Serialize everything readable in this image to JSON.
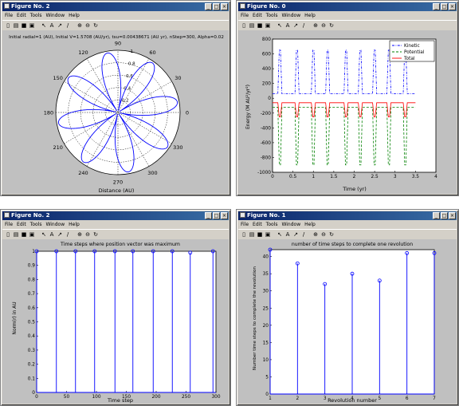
{
  "menu": [
    "File",
    "Edit",
    "Tools",
    "Window",
    "Help"
  ],
  "windows": [
    {
      "title": "Figure No. 2"
    },
    {
      "title": "Figure No. 0"
    },
    {
      "title": "Figure No. 2"
    },
    {
      "title": "Figure No. 1"
    }
  ],
  "window_buttons": [
    "_",
    "□",
    "×"
  ],
  "toolbar_icons": [
    "new-file-icon",
    "open-icon",
    "save-icon",
    "print-icon",
    "select-arrow-icon",
    "text-icon",
    "arrow-icon",
    "line-icon",
    "zoom-in-icon",
    "zoom-out-icon",
    "rotate-icon"
  ],
  "colors": {
    "blue": "#0000ff",
    "green": "#008000",
    "red": "#ff0000",
    "titlebar": "#0a246a"
  },
  "chart_data": [
    {
      "type": "polar",
      "title": "Initial radial=1 (AU), Initial V=1.5708 (AU/yr), tsu=0.00438671 (AU yr), nStep=300, Alpha=0.02",
      "xlabel": "Distance (AU)",
      "r_ticks": [
        "0.2",
        "0.4",
        "0.6",
        "0.8",
        "1"
      ],
      "angle_labels": [
        "90",
        "60",
        "30",
        "0",
        "330",
        "300",
        "270",
        "240",
        "210",
        "180",
        "150",
        "120"
      ],
      "rlim": [
        0,
        1
      ],
      "curve": {
        "shape": "rose",
        "petals": 8,
        "r_min": 0.03,
        "r_max": 0.97,
        "rotation_deg": 10
      }
    },
    {
      "type": "line",
      "title": "",
      "xlabel": "Time (yr)",
      "ylabel": "Energy (M AU²/yr²)",
      "xlim": [
        0,
        4
      ],
      "ylim": [
        -1000,
        800
      ],
      "xticks": [
        "0",
        "0.5",
        "1",
        "1.5",
        "2",
        "2.5",
        "3",
        "3.5",
        "4"
      ],
      "yticks": [
        "-1000",
        "-800",
        "-600",
        "-400",
        "-200",
        "0",
        "200",
        "400",
        "600",
        "800"
      ],
      "legend": {
        "position": "top-right",
        "entries": [
          "Kinetic",
          "Potential",
          "Total"
        ]
      },
      "spike_times": [
        0.18,
        0.6,
        1.0,
        1.35,
        1.8,
        2.15,
        2.5,
        2.85,
        3.25
      ],
      "series": [
        {
          "name": "Kinetic",
          "style": "dash-dot",
          "color": "#0000ff",
          "baseline": 60,
          "peak": 650
        },
        {
          "name": "Potential",
          "style": "dash",
          "color": "#008000",
          "baseline": -120,
          "peak": -900
        },
        {
          "name": "Total",
          "style": "solid",
          "color": "#ff0000",
          "baseline": -60,
          "peak": -250
        }
      ]
    },
    {
      "type": "stem",
      "title": "Time steps where position vector was maximum",
      "xlabel": "Time step",
      "ylabel": "Norm(r) in AU",
      "xlim": [
        0,
        300
      ],
      "ylim": [
        0,
        1
      ],
      "xticks": [
        "0",
        "50",
        "100",
        "150",
        "200",
        "250",
        "300"
      ],
      "yticks": [
        "0",
        "0.1",
        "0.2",
        "0.3",
        "0.4",
        "0.5",
        "0.6",
        "0.7",
        "0.8",
        "0.9",
        "1"
      ],
      "x": [
        0,
        33,
        65,
        97,
        131,
        161,
        195,
        227,
        257,
        295
      ],
      "values": [
        1,
        1,
        1,
        1,
        1,
        1,
        1,
        1,
        0.99,
        1
      ]
    },
    {
      "type": "stem",
      "title": "number of time steps to complete one revolution",
      "xlabel": "Revolution number",
      "ylabel": "Number time steps to complete the revolution",
      "xlim": [
        1,
        7
      ],
      "ylim": [
        0,
        42
      ],
      "xticks": [
        "1",
        "2",
        "3",
        "4",
        "5",
        "6",
        "7"
      ],
      "yticks": [
        "0",
        "5",
        "10",
        "15",
        "20",
        "25",
        "30",
        "35",
        "40"
      ],
      "x": [
        1,
        2,
        3,
        4,
        5,
        6,
        7
      ],
      "values": [
        42,
        38,
        32,
        35,
        33,
        41,
        41
      ]
    }
  ]
}
